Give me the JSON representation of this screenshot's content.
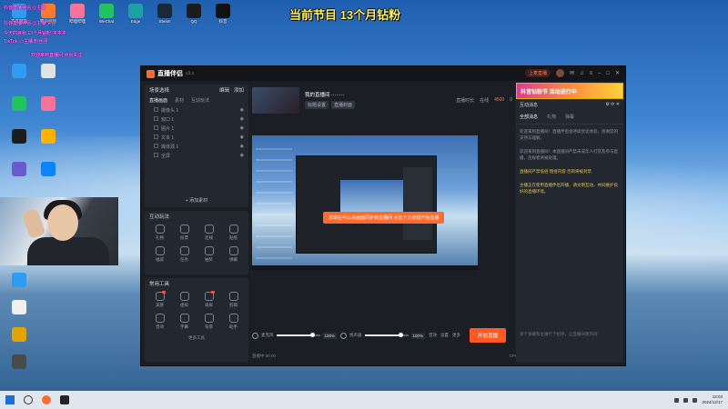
{
  "banner": "当前节目 13个月钻粉",
  "desktop": {
    "icons": [
      {
        "label": "百度网盘",
        "color": "#2f9cf3"
      },
      {
        "label": "腾讯视频",
        "color": "#ff7a2f"
      },
      {
        "label": "哔哩哔哩",
        "color": "#fb7299"
      },
      {
        "label": "WeChat",
        "color": "#22c35d"
      },
      {
        "label": "Edge",
        "color": "#1fa0a6"
      },
      {
        "label": "Steam",
        "color": "#1b2838"
      },
      {
        "label": "QQ",
        "color": "#1c1c1c"
      },
      {
        "label": "抖音",
        "color": "#111111"
      }
    ],
    "pink_lines": [
      "抖音直播伴侣 @主播",
      "抖音直播伴侣 @主播 关注",
      "今天的目标 13个月钻粉 冲冲冲",
      "TikTok @主播 粉丝团",
      "欢迎来到直播间 点点关注"
    ]
  },
  "app": {
    "name": "直播伴侣",
    "version": "v3.x",
    "live_label": "上麦直播",
    "left": {
      "scene_title": "场景选择",
      "scene_actions": [
        "编辑",
        "添加"
      ],
      "source_tabs": [
        "直播画面",
        "素材",
        "互动玩法"
      ],
      "sources": [
        "摄像头 1",
        "窗口 1",
        "图片 1",
        "文本 1",
        "媒体源 1",
        "全屏"
      ],
      "add_source": "+ 添加素材",
      "interact_title": "互动玩法",
      "interact": [
        "礼物",
        "投票",
        "连线",
        "贴纸",
        "福袋",
        "任务",
        "抽奖",
        "弹幕"
      ],
      "tools_title": "常用工具",
      "tools": [
        "美颜",
        "虚拟",
        "录屏",
        "剪辑",
        "音效",
        "字幕",
        "背景",
        "助手"
      ],
      "more_tools": "更多工具"
    },
    "scene": {
      "title": "我的直播间 ········",
      "btns": [
        "标题设置",
        "直播封面"
      ],
      "stats": [
        "直播时长",
        "在线",
        "4500",
        "0"
      ]
    },
    "toast": "您现在可以将画面同步到直播间 点击下方按钮开始直播",
    "mixer": [
      {
        "label": "麦克风",
        "value": "100%",
        "level": 0.82
      },
      {
        "label": "扬声器",
        "value": "100%",
        "level": 0.82
      }
    ],
    "mixer_extra": [
      "音效",
      "设置",
      "更多"
    ],
    "start_live": "开始直播",
    "status_left": "直播中 00:00",
    "status_stats": [
      "CPU 0%",
      "帧率 30",
      "码率 0kbps",
      "丢帧 0%",
      "流量 0MB"
    ],
    "right": {
      "promo": "抖音钻粉节 活动进行中",
      "head": "互动消息",
      "tabs": [
        "全部消息",
        "礼物",
        "弹幕"
      ],
      "messages": [
        {
          "text": "欢迎来到直播间！直播伴侣会持续优化体验，感谢您的支持与理解。",
          "hl": false
        },
        {
          "text": "欢迎来到直播间！本直播间严禁未成年人打赏及参与直播，违规者将被处理。",
          "hl": false
        },
        {
          "text": "直播间严禁低俗 粗俗内容 否则将被封禁",
          "hl": true
        },
        {
          "text": "主播正在使用直播伴侣开播，请文明互动，共同维护良好的直播环境。",
          "hl": true
        }
      ],
      "input_hint": "发个弹幕和主播打个招呼，让直播间更热闹"
    }
  },
  "taskbar": {
    "time": "13:03",
    "date": "2024/12/17"
  }
}
